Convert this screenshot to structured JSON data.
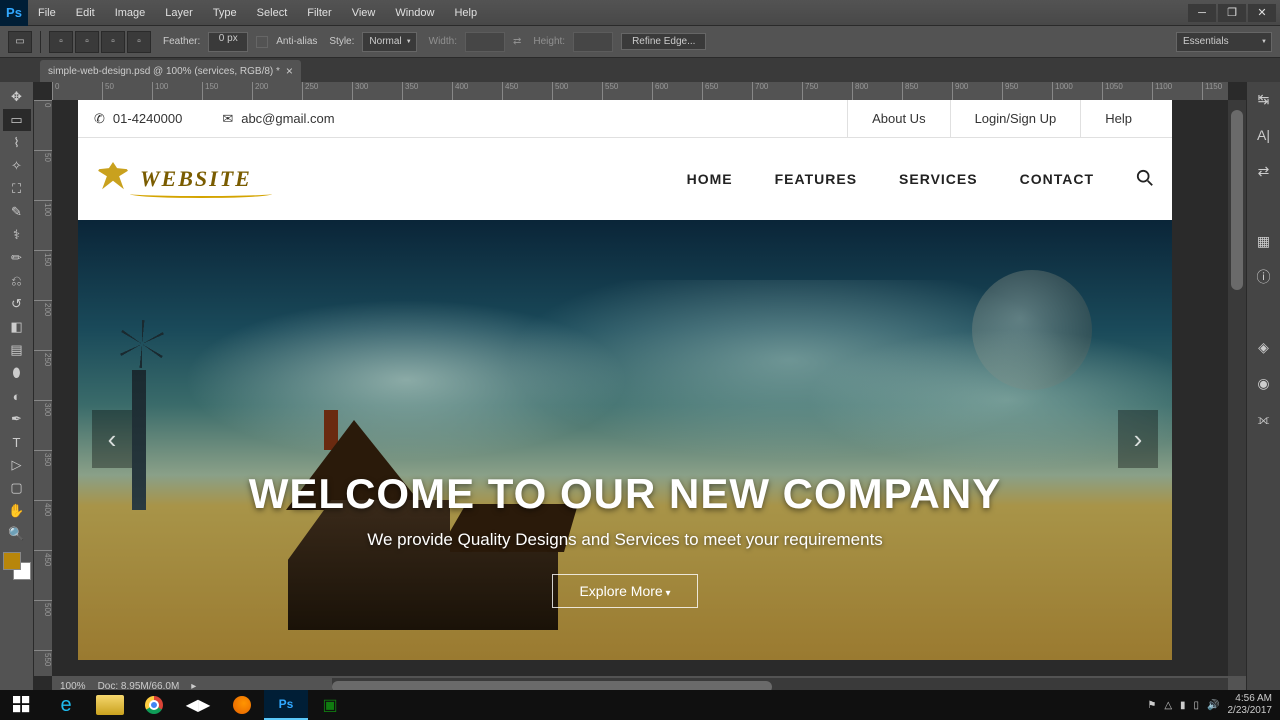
{
  "app": {
    "logo": "Ps"
  },
  "menu": [
    "File",
    "Edit",
    "Image",
    "Layer",
    "Type",
    "Select",
    "Filter",
    "View",
    "Window",
    "Help"
  ],
  "options": {
    "feather_label": "Feather:",
    "feather_value": "0 px",
    "antialias": "Anti-alias",
    "style_label": "Style:",
    "style_value": "Normal",
    "width_label": "Width:",
    "height_label": "Height:",
    "refine": "Refine Edge...",
    "workspace": "Essentials"
  },
  "tab": {
    "title": "simple-web-design.psd @ 100% (services, RGB/8) *"
  },
  "ruler_h": [
    0,
    50,
    100,
    150,
    200,
    250,
    300,
    350,
    400,
    450,
    500,
    550,
    600,
    650,
    700,
    750,
    800,
    850,
    900,
    950,
    1000,
    1050,
    1100,
    1150
  ],
  "ruler_v": [
    0,
    50,
    100,
    150,
    200,
    250,
    300,
    350,
    400,
    450,
    500,
    550
  ],
  "status": {
    "zoom": "100%",
    "doc": "Doc: 8.95M/66.0M"
  },
  "website": {
    "topbar": {
      "phone": "01-4240000",
      "email": "abc@gmail.com",
      "links": [
        "About Us",
        "Login/Sign Up",
        "Help"
      ]
    },
    "logo": "WEBSITE",
    "nav": [
      "HOME",
      "FEATURES",
      "SERVICES",
      "CONTACT"
    ],
    "hero": {
      "title": "WELCOME TO OUR NEW COMPANY",
      "subtitle": "We provide Quality Designs and Services to meet your requirements",
      "cta": "Explore More"
    }
  },
  "taskbar": {
    "time": "4:56 AM",
    "date": "2/23/2017"
  }
}
